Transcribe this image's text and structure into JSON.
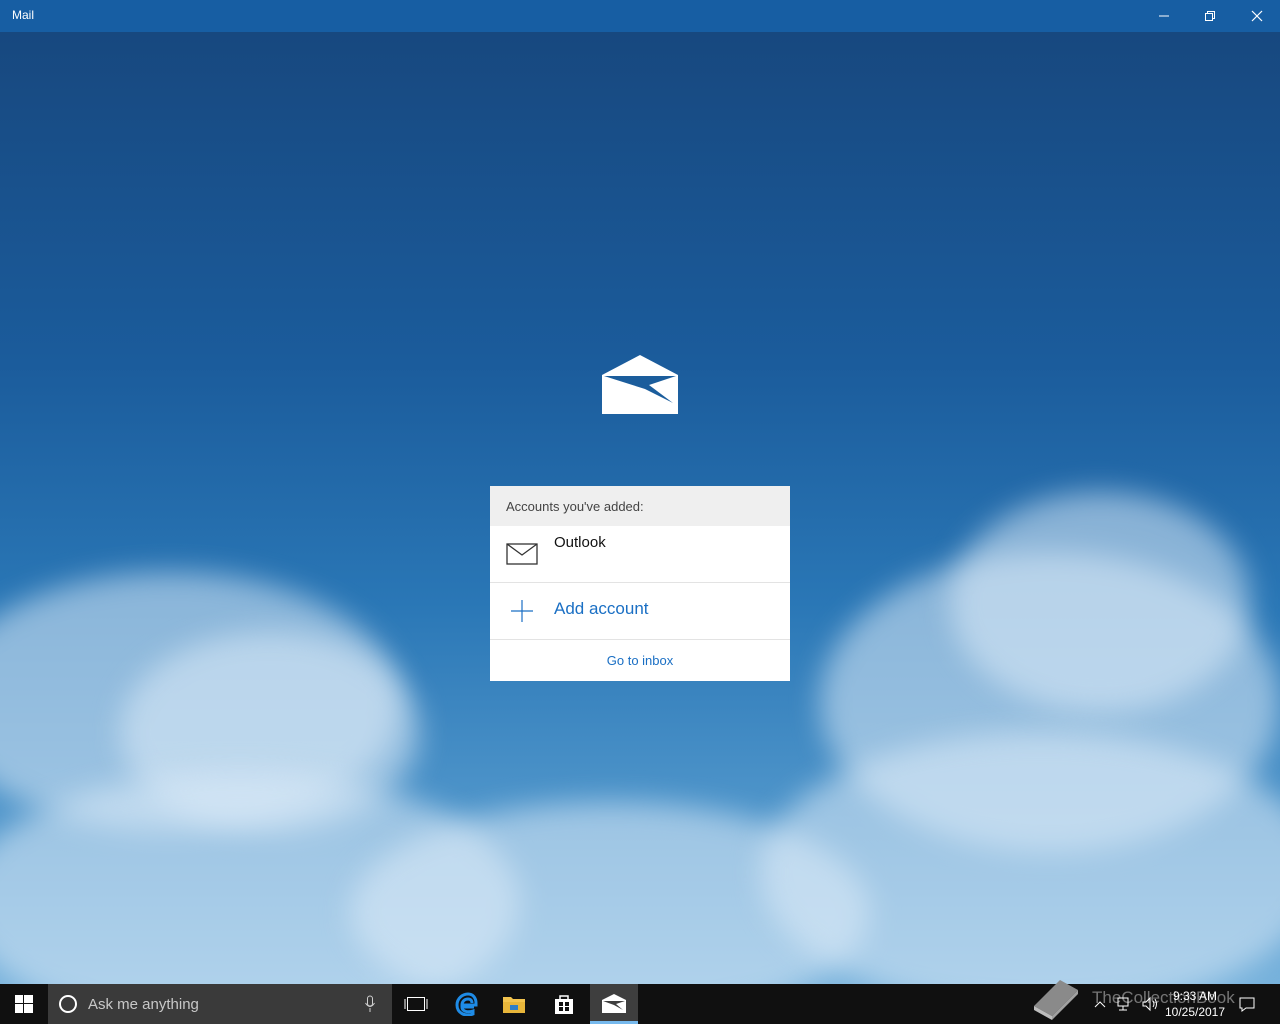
{
  "window": {
    "title": "Mail"
  },
  "panel": {
    "header": "Accounts you've added:",
    "accounts": [
      {
        "name": "Outlook",
        "icon": "mail-icon"
      }
    ],
    "add_account": "Add account",
    "go_to_inbox": "Go to inbox"
  },
  "taskbar": {
    "search_placeholder": "Ask me anything",
    "time": "9:33 AM",
    "date": "10/25/2017",
    "watermark": "TheCollectionBook"
  },
  "colors": {
    "titlebar": "#175ea3",
    "link": "#1a6fc4",
    "taskbar": "#101010",
    "active_underline": "#76b9ed"
  }
}
